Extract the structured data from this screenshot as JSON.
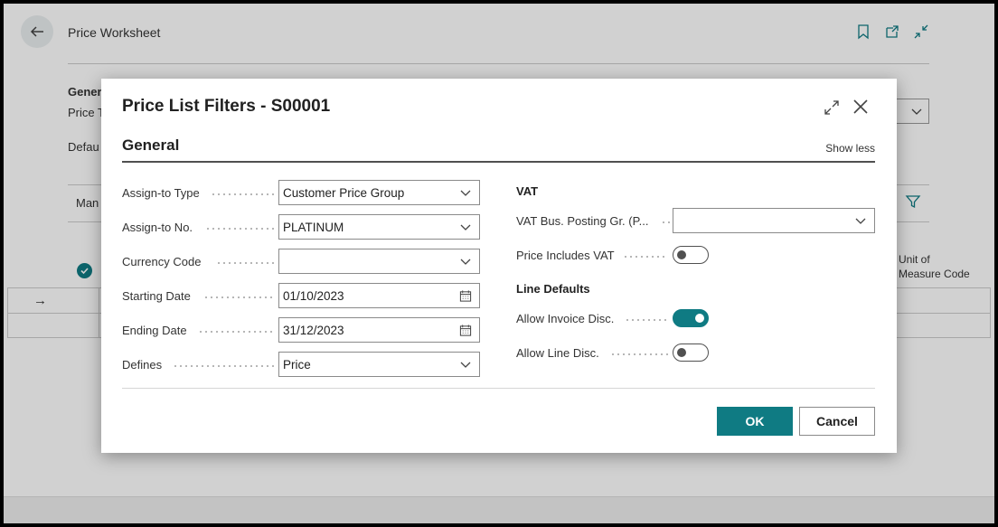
{
  "background": {
    "page_title": "Price Worksheet",
    "general_label_partial": "Gener",
    "price_type_partial": "Price T",
    "defaults_partial": "Defau",
    "manage_partial": "Man",
    "uom_header_line1": "Unit of",
    "uom_header_line2": "Measure Code"
  },
  "dialog": {
    "title": "Price List Filters - S00001",
    "section_title": "General",
    "show_less": "Show less",
    "left_fields": [
      {
        "label": "Assign-to Type",
        "value": "Customer Price Group",
        "control": "dropdown"
      },
      {
        "label": "Assign-to No.",
        "value": "PLATINUM",
        "control": "dropdown"
      },
      {
        "label": "Currency Code",
        "value": "",
        "control": "dropdown"
      },
      {
        "label": "Starting Date",
        "value": "01/10/2023",
        "control": "date"
      },
      {
        "label": "Ending Date",
        "value": "31/12/2023",
        "control": "date"
      },
      {
        "label": "Defines",
        "value": "Price",
        "control": "dropdown"
      }
    ],
    "vat": {
      "heading": "VAT",
      "vat_bus_posting_label": "VAT Bus. Posting Gr. (P...",
      "vat_bus_posting_value": "",
      "price_includes_vat_label": "Price Includes VAT",
      "price_includes_vat": false
    },
    "line_defaults": {
      "heading": "Line Defaults",
      "allow_invoice_disc_label": "Allow Invoice Disc.",
      "allow_invoice_disc": true,
      "allow_line_disc_label": "Allow Line Disc.",
      "allow_line_disc": false
    },
    "ok_label": "OK",
    "cancel_label": "Cancel"
  },
  "colors": {
    "accent": "#0f7b83",
    "text": "#212121"
  }
}
